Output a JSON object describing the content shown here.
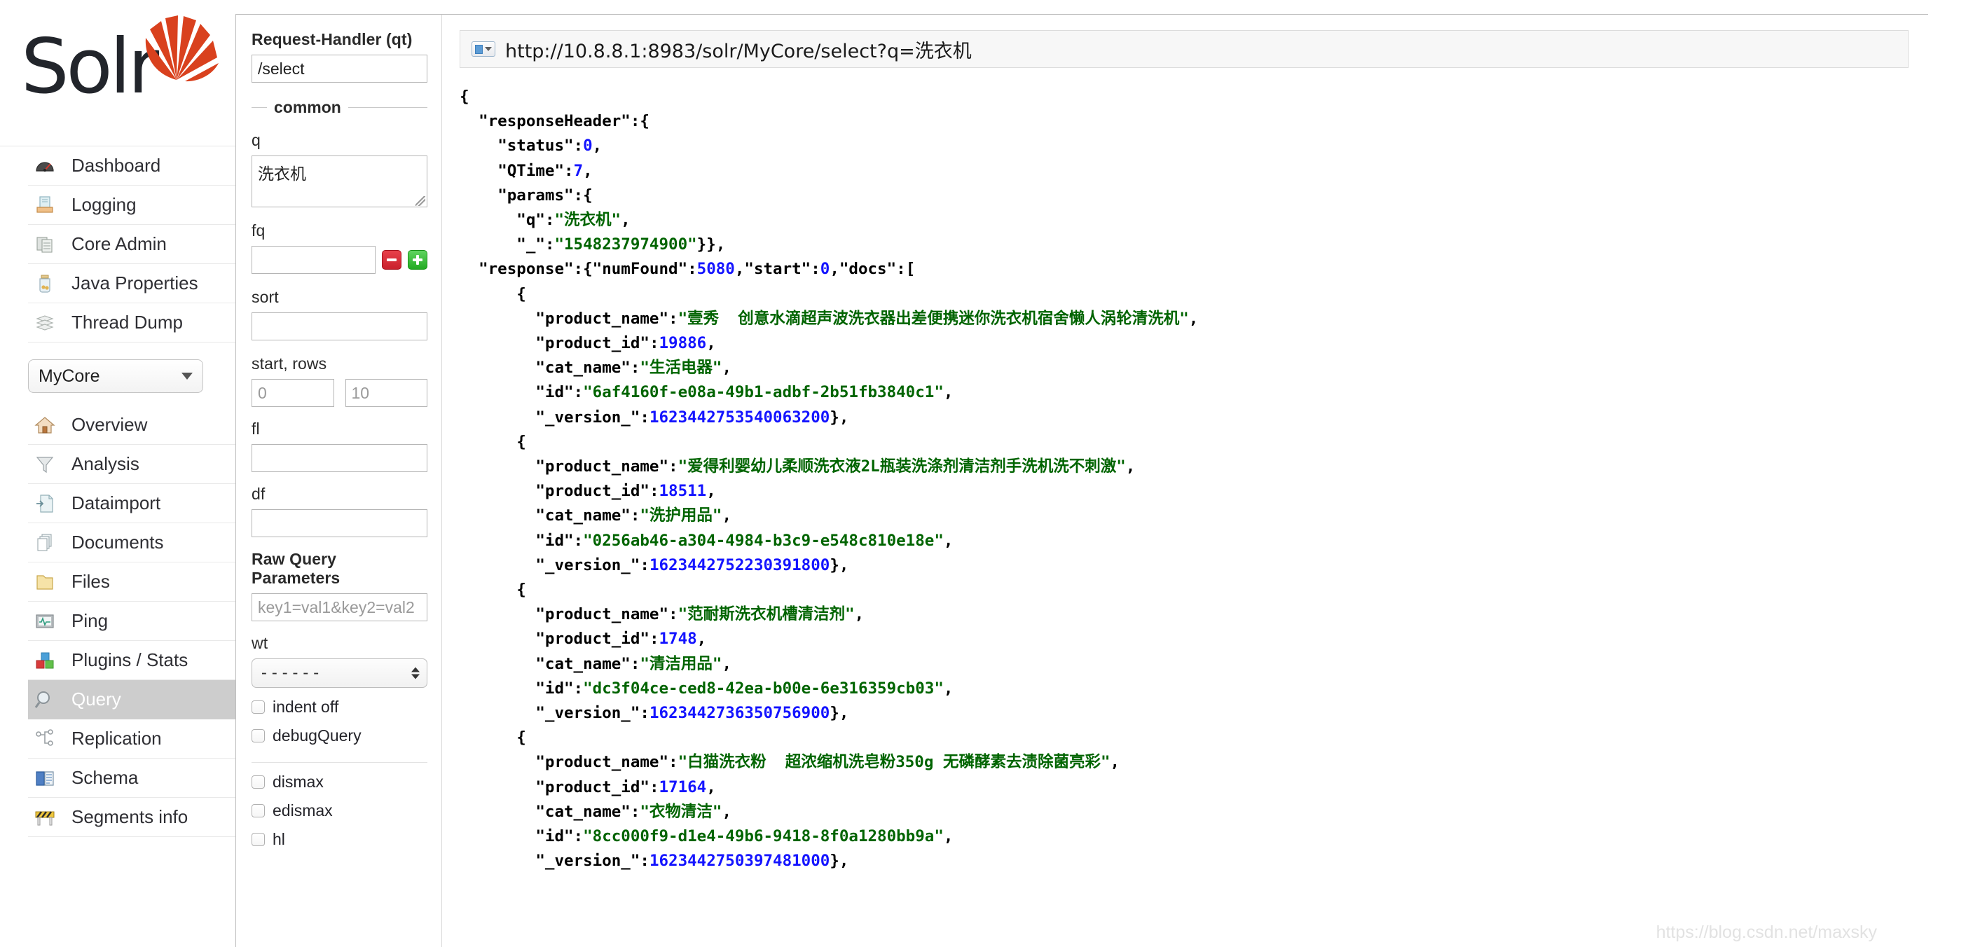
{
  "app": {
    "logo_text": "Solr",
    "watermark": "https://blog.csdn.net/maxsky"
  },
  "sidebar": {
    "global_items": [
      {
        "label": "Dashboard",
        "icon": "dashboard-gauge-icon"
      },
      {
        "label": "Logging",
        "icon": "logging-tray-icon"
      },
      {
        "label": "Core Admin",
        "icon": "core-admin-servers-icon"
      },
      {
        "label": "Java Properties",
        "icon": "java-properties-jar-icon"
      },
      {
        "label": "Thread Dump",
        "icon": "thread-dump-stack-icon"
      }
    ],
    "core_selector": {
      "value": "MyCore"
    },
    "core_items": [
      {
        "label": "Overview",
        "icon": "home-icon",
        "active": false
      },
      {
        "label": "Analysis",
        "icon": "funnel-icon",
        "active": false
      },
      {
        "label": "Dataimport",
        "icon": "dataimport-page-icon",
        "active": false
      },
      {
        "label": "Documents",
        "icon": "documents-stack-icon",
        "active": false
      },
      {
        "label": "Files",
        "icon": "folder-icon",
        "active": false
      },
      {
        "label": "Ping",
        "icon": "ping-monitor-icon",
        "active": false
      },
      {
        "label": "Plugins / Stats",
        "icon": "plugins-blocks-icon",
        "active": false
      },
      {
        "label": "Query",
        "icon": "magnifier-icon",
        "active": true
      },
      {
        "label": "Replication",
        "icon": "replication-nodes-icon",
        "active": false
      },
      {
        "label": "Schema",
        "icon": "schema-book-icon",
        "active": false
      },
      {
        "label": "Segments info",
        "icon": "segments-barrier-icon",
        "active": false
      }
    ]
  },
  "query_form": {
    "request_handler": {
      "label": "Request-Handler (qt)",
      "value": "/select"
    },
    "common_legend": "common",
    "q": {
      "label": "q",
      "value": "洗衣机"
    },
    "fq": {
      "label": "fq",
      "value": "",
      "remove_button": "–",
      "add_button": "+"
    },
    "sort": {
      "label": "sort",
      "value": ""
    },
    "start_rows": {
      "label": "start, rows",
      "start": "0",
      "rows": "10"
    },
    "fl": {
      "label": "fl",
      "value": ""
    },
    "df": {
      "label": "df",
      "value": ""
    },
    "raw_query_parameters": {
      "label": "Raw Query Parameters",
      "placeholder": "key1=val1&key2=val2"
    },
    "wt": {
      "label": "wt",
      "value": "------"
    },
    "checkboxes": [
      {
        "label": "indent off",
        "checked": false
      },
      {
        "label": "debugQuery",
        "checked": false
      }
    ],
    "parser_checkboxes": [
      {
        "label": "dismax",
        "checked": false
      },
      {
        "label": "edismax",
        "bold_prefix": "e",
        "checked": false
      },
      {
        "label": "hl",
        "checked": false
      }
    ]
  },
  "result": {
    "url": "http://10.8.8.1:8983/solr/MyCore/select?q=洗衣机",
    "url_icon": "url-page-dropdown-icon",
    "response": {
      "responseHeader": {
        "status": 0,
        "QTime": 7,
        "params": {
          "q": "洗衣机",
          "_": "1548237974900"
        }
      },
      "numFound": 5080,
      "start": 0,
      "docs": [
        {
          "product_name": "壹秀  创意水滴超声波洗衣器出差便携迷你洗衣机宿舍懒人涡轮清洗机",
          "product_id": 19886,
          "cat_name": "生活电器",
          "id": "6af4160f-e08a-49b1-adbf-2b51fb3840c1",
          "_version_": 1623442753540063233
        },
        {
          "product_name": "爱得利婴幼儿柔顺洗衣液2L瓶装洗涤剂清洁剂手洗机洗不刺激",
          "product_id": 18511,
          "cat_name": "洗护用品",
          "id": "0256ab46-a304-4984-b3c9-e548c810e18e",
          "_version_": 1623442752230391808
        },
        {
          "product_name": "范耐斯洗衣机槽清洁剂",
          "product_id": 1748,
          "cat_name": "清洁用品",
          "id": "dc3f04ce-ced8-42ea-b00e-6e316359cb03",
          "_version_": 1623442736350756865
        },
        {
          "product_name": "白猫洗衣粉  超浓缩机洗皂粉350g 无磷酵素去渍除菌亮彩",
          "product_id": 17164,
          "cat_name": "衣物清洁",
          "id": "8cc000f9-d1e4-49b6-9418-8f0a1280bb9a",
          "_version_": 1623442750397480962
        }
      ]
    }
  }
}
